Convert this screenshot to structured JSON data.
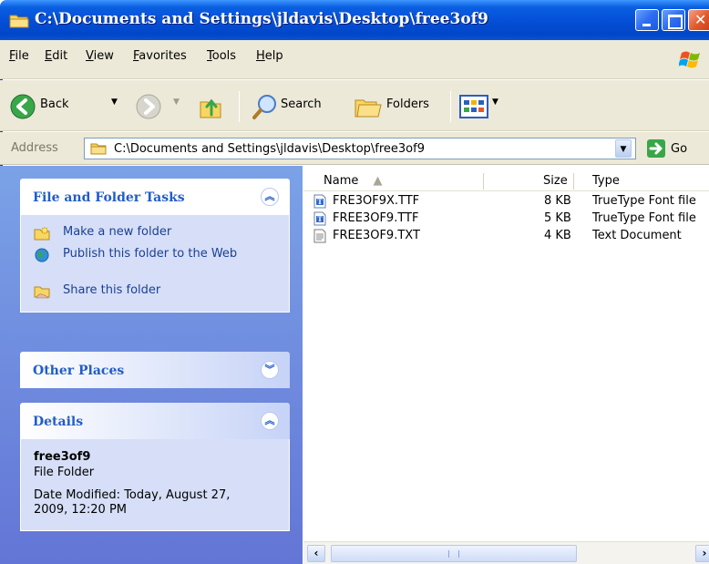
{
  "window": {
    "title": "C:\\Documents and Settings\\jldavis\\Desktop\\free3of9"
  },
  "menu": {
    "items": [
      "File",
      "Edit",
      "View",
      "Favorites",
      "Tools",
      "Help"
    ]
  },
  "toolbar": {
    "back_label": "Back",
    "search_label": "Search",
    "folders_label": "Folders"
  },
  "address": {
    "label": "Address",
    "value": "C:\\Documents and Settings\\jldavis\\Desktop\\free3of9",
    "go_label": "Go"
  },
  "tasks_panel": {
    "title": "File and Folder Tasks",
    "items": [
      {
        "label": "Make a new folder",
        "icon": "new-folder-icon"
      },
      {
        "label": "Publish this folder to the Web",
        "icon": "publish-web-icon"
      },
      {
        "label": "Share this folder",
        "icon": "share-folder-icon"
      }
    ]
  },
  "other_places": {
    "title": "Other Places"
  },
  "details": {
    "title": "Details",
    "name": "free3of9",
    "type": "File Folder",
    "modified": "Date Modified: Today, August 27, 2009, 12:20 PM"
  },
  "columns": {
    "name": "Name",
    "size": "Size",
    "type": "Type"
  },
  "files": [
    {
      "name": "FRE3OF9X.TTF",
      "size": "8 KB",
      "type": "TrueType Font file",
      "icon": "font-file-icon"
    },
    {
      "name": "FREE3OF9.TTF",
      "size": "5 KB",
      "type": "TrueType Font file",
      "icon": "font-file-icon"
    },
    {
      "name": "FREE3OF9.TXT",
      "size": "4 KB",
      "type": "Text Document",
      "icon": "text-file-icon"
    }
  ],
  "colors": {
    "titlebar": "#0550d8",
    "taskpane_top": "#7ba2e7",
    "taskpane_bottom": "#6375d6",
    "panel_title": "#215dc6",
    "chrome": "#ece9d8"
  }
}
